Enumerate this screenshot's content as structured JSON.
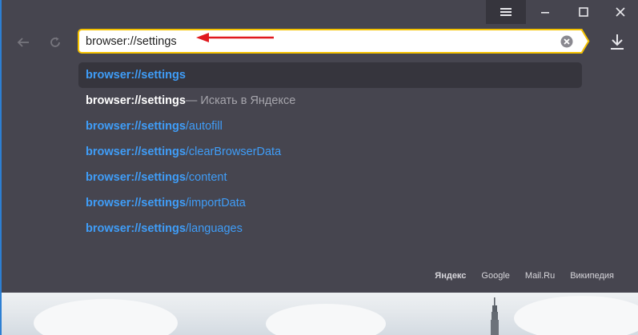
{
  "omnibox": {
    "value": "browser://settings"
  },
  "suggestions": [
    {
      "bold": "browser://settings",
      "rest": "",
      "kind": "link",
      "selected": true
    },
    {
      "bold": "browser://settings",
      "rest": " — Искать в Яндексе",
      "kind": "search",
      "selected": false
    },
    {
      "bold": "browser://settings",
      "rest": "/autofill",
      "kind": "link",
      "selected": false
    },
    {
      "bold": "browser://settings",
      "rest": "/clearBrowserData",
      "kind": "link",
      "selected": false
    },
    {
      "bold": "browser://settings",
      "rest": "/content",
      "kind": "link",
      "selected": false
    },
    {
      "bold": "browser://settings",
      "rest": "/importData",
      "kind": "link",
      "selected": false
    },
    {
      "bold": "browser://settings",
      "rest": "/languages",
      "kind": "link",
      "selected": false
    }
  ],
  "footer": {
    "yandex": "Яндекс",
    "google": "Google",
    "mailru": "Mail.Ru",
    "wikipedia": "Википедия"
  },
  "icons": {
    "menu": "hamburger-menu-icon",
    "minimize": "minimize-icon",
    "maximize": "maximize-icon",
    "close": "close-icon",
    "back": "back-arrow-icon",
    "reload": "reload-icon",
    "clear": "clear-input-icon",
    "download": "download-icon"
  },
  "colors": {
    "background": "#46454f",
    "accent_border": "#f5c200",
    "link": "#3f9df8",
    "annotation_arrow": "#e0191e"
  }
}
